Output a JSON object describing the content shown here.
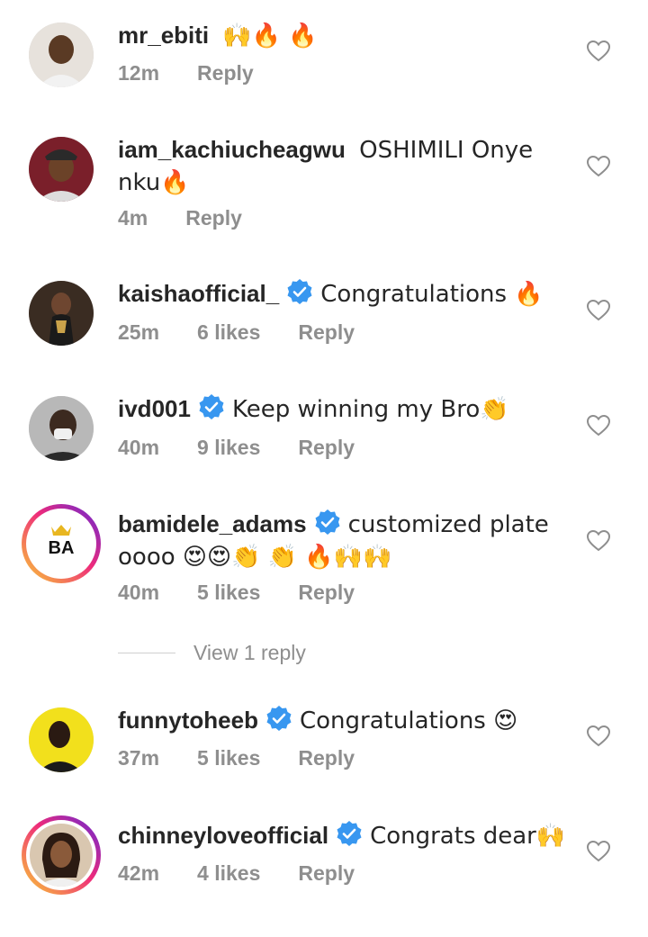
{
  "comments": [
    {
      "username": "mr_ebiti",
      "verified": false,
      "text": "🙌🔥 🔥",
      "time": "12m",
      "likes": "",
      "reply": "Reply"
    },
    {
      "username": "iam_kachiucheagwu",
      "verified": false,
      "text": "OSHIMILI Onye nku🔥",
      "time": "4m",
      "likes": "",
      "reply": "Reply"
    },
    {
      "username": "kaishaofficial_",
      "verified": true,
      "text": "Congratulations 🔥",
      "time": "25m",
      "likes": "6 likes",
      "reply": "Reply"
    },
    {
      "username": "ivd001",
      "verified": true,
      "text": "Keep winning my Bro👏",
      "time": "40m",
      "likes": "9 likes",
      "reply": "Reply"
    },
    {
      "username": "bamidele_adams",
      "verified": true,
      "text": "customized plate oooo 😍😍👏 👏 🔥🙌🙌",
      "time": "40m",
      "likes": "5 likes",
      "reply": "Reply"
    },
    {
      "username": "funnytoheeb",
      "verified": true,
      "text": "Congratulations 😍",
      "time": "37m",
      "likes": "5 likes",
      "reply": "Reply"
    },
    {
      "username": "chinneyloveofficial",
      "verified": true,
      "text": "Congrats dear🙌",
      "time": "42m",
      "likes": "4 likes",
      "reply": "Reply"
    }
  ],
  "view_replies_label": "View 1 reply",
  "avatar_logo_text": "BA",
  "colors": {
    "verified": "#3897f0",
    "meta": "#8e8e8e",
    "text": "#262626"
  }
}
